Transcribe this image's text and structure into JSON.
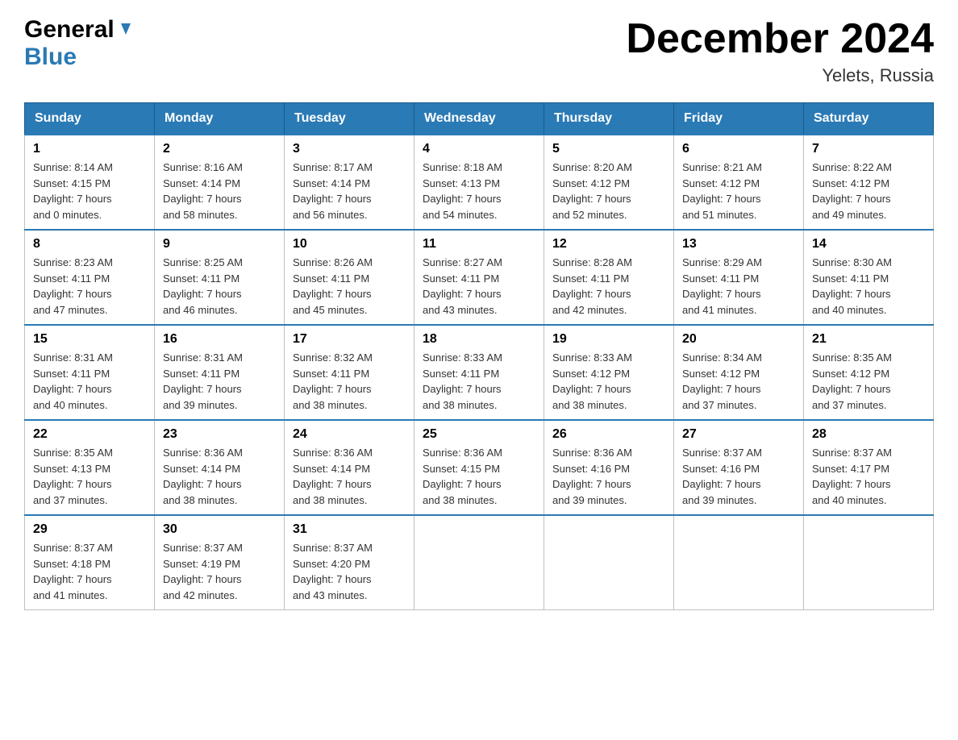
{
  "logo": {
    "general": "General",
    "blue": "Blue"
  },
  "title": "December 2024",
  "location": "Yelets, Russia",
  "days_of_week": [
    "Sunday",
    "Monday",
    "Tuesday",
    "Wednesday",
    "Thursday",
    "Friday",
    "Saturday"
  ],
  "weeks": [
    [
      {
        "day": "1",
        "sunrise": "8:14 AM",
        "sunset": "4:15 PM",
        "daylight": "7 hours and 0 minutes."
      },
      {
        "day": "2",
        "sunrise": "8:16 AM",
        "sunset": "4:14 PM",
        "daylight": "7 hours and 58 minutes."
      },
      {
        "day": "3",
        "sunrise": "8:17 AM",
        "sunset": "4:14 PM",
        "daylight": "7 hours and 56 minutes."
      },
      {
        "day": "4",
        "sunrise": "8:18 AM",
        "sunset": "4:13 PM",
        "daylight": "7 hours and 54 minutes."
      },
      {
        "day": "5",
        "sunrise": "8:20 AM",
        "sunset": "4:12 PM",
        "daylight": "7 hours and 52 minutes."
      },
      {
        "day": "6",
        "sunrise": "8:21 AM",
        "sunset": "4:12 PM",
        "daylight": "7 hours and 51 minutes."
      },
      {
        "day": "7",
        "sunrise": "8:22 AM",
        "sunset": "4:12 PM",
        "daylight": "7 hours and 49 minutes."
      }
    ],
    [
      {
        "day": "8",
        "sunrise": "8:23 AM",
        "sunset": "4:11 PM",
        "daylight": "7 hours and 47 minutes."
      },
      {
        "day": "9",
        "sunrise": "8:25 AM",
        "sunset": "4:11 PM",
        "daylight": "7 hours and 46 minutes."
      },
      {
        "day": "10",
        "sunrise": "8:26 AM",
        "sunset": "4:11 PM",
        "daylight": "7 hours and 45 minutes."
      },
      {
        "day": "11",
        "sunrise": "8:27 AM",
        "sunset": "4:11 PM",
        "daylight": "7 hours and 43 minutes."
      },
      {
        "day": "12",
        "sunrise": "8:28 AM",
        "sunset": "4:11 PM",
        "daylight": "7 hours and 42 minutes."
      },
      {
        "day": "13",
        "sunrise": "8:29 AM",
        "sunset": "4:11 PM",
        "daylight": "7 hours and 41 minutes."
      },
      {
        "day": "14",
        "sunrise": "8:30 AM",
        "sunset": "4:11 PM",
        "daylight": "7 hours and 40 minutes."
      }
    ],
    [
      {
        "day": "15",
        "sunrise": "8:31 AM",
        "sunset": "4:11 PM",
        "daylight": "7 hours and 40 minutes."
      },
      {
        "day": "16",
        "sunrise": "8:31 AM",
        "sunset": "4:11 PM",
        "daylight": "7 hours and 39 minutes."
      },
      {
        "day": "17",
        "sunrise": "8:32 AM",
        "sunset": "4:11 PM",
        "daylight": "7 hours and 38 minutes."
      },
      {
        "day": "18",
        "sunrise": "8:33 AM",
        "sunset": "4:11 PM",
        "daylight": "7 hours and 38 minutes."
      },
      {
        "day": "19",
        "sunrise": "8:33 AM",
        "sunset": "4:12 PM",
        "daylight": "7 hours and 38 minutes."
      },
      {
        "day": "20",
        "sunrise": "8:34 AM",
        "sunset": "4:12 PM",
        "daylight": "7 hours and 37 minutes."
      },
      {
        "day": "21",
        "sunrise": "8:35 AM",
        "sunset": "4:12 PM",
        "daylight": "7 hours and 37 minutes."
      }
    ],
    [
      {
        "day": "22",
        "sunrise": "8:35 AM",
        "sunset": "4:13 PM",
        "daylight": "7 hours and 37 minutes."
      },
      {
        "day": "23",
        "sunrise": "8:36 AM",
        "sunset": "4:14 PM",
        "daylight": "7 hours and 38 minutes."
      },
      {
        "day": "24",
        "sunrise": "8:36 AM",
        "sunset": "4:14 PM",
        "daylight": "7 hours and 38 minutes."
      },
      {
        "day": "25",
        "sunrise": "8:36 AM",
        "sunset": "4:15 PM",
        "daylight": "7 hours and 38 minutes."
      },
      {
        "day": "26",
        "sunrise": "8:36 AM",
        "sunset": "4:16 PM",
        "daylight": "7 hours and 39 minutes."
      },
      {
        "day": "27",
        "sunrise": "8:37 AM",
        "sunset": "4:16 PM",
        "daylight": "7 hours and 39 minutes."
      },
      {
        "day": "28",
        "sunrise": "8:37 AM",
        "sunset": "4:17 PM",
        "daylight": "7 hours and 40 minutes."
      }
    ],
    [
      {
        "day": "29",
        "sunrise": "8:37 AM",
        "sunset": "4:18 PM",
        "daylight": "7 hours and 41 minutes."
      },
      {
        "day": "30",
        "sunrise": "8:37 AM",
        "sunset": "4:19 PM",
        "daylight": "7 hours and 42 minutes."
      },
      {
        "day": "31",
        "sunrise": "8:37 AM",
        "sunset": "4:20 PM",
        "daylight": "7 hours and 43 minutes."
      },
      null,
      null,
      null,
      null
    ]
  ],
  "labels": {
    "sunrise": "Sunrise:",
    "sunset": "Sunset:",
    "daylight": "Daylight:"
  }
}
